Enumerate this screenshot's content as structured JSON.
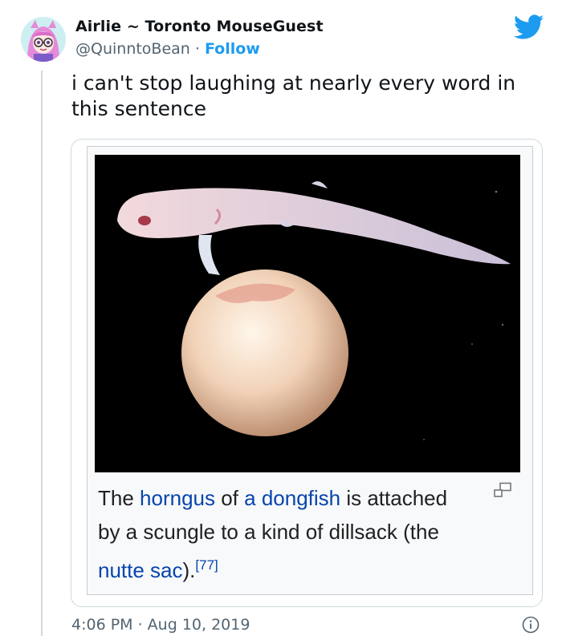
{
  "author": {
    "display_name": "Airlie ~ Toronto MouseGuest",
    "handle": "@QuinntoBean",
    "separator": " · ",
    "follow_label": "Follow",
    "avatar_icon": "anime-avatar-icon"
  },
  "brand": {
    "icon": "twitter-bird-icon",
    "color": "#1d9bf0"
  },
  "tweet": {
    "text": "i can't stop laughing at nearly every word in this sentence"
  },
  "media": {
    "image_icon": "photo-shark-embryo",
    "caption": {
      "t1": "The ",
      "l1": "horngus",
      "t2": " of ",
      "l2": "a dongfish",
      "t3": " is attached by a scungle to a kind of dillsack (the ",
      "l3": "nutte sac",
      "t4": ").",
      "ref": "[77]"
    },
    "enlarge_icon": "enlarge-icon"
  },
  "footer": {
    "timestamp": "4:06 PM · Aug 10, 2019",
    "info_icon": "info-icon"
  },
  "colors": {
    "text": "#0f1419",
    "muted": "#536471",
    "accent": "#1d9bf0",
    "wiki_link": "#0645ad"
  }
}
